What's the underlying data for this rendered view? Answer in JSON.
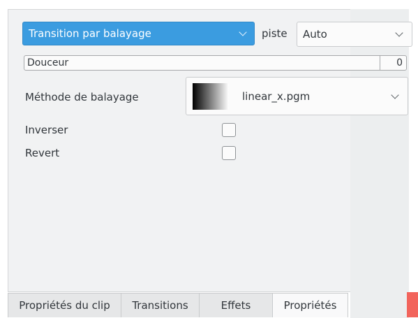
{
  "transition": {
    "selected": "Transition par balayage"
  },
  "track": {
    "label": "piste",
    "selected": "Auto"
  },
  "softness": {
    "label": "Douceur",
    "value": "0"
  },
  "wipe_method": {
    "label": "Méthode de balayage",
    "selected": "linear_x.pgm"
  },
  "options": [
    {
      "label": "Inverser",
      "checked": false
    },
    {
      "label": "Revert",
      "checked": false
    }
  ],
  "tabs": [
    {
      "label": "Propriétés du clip",
      "active": false
    },
    {
      "label": "Transitions",
      "active": false
    },
    {
      "label": "Effets",
      "active": false
    },
    {
      "label": "Propriétés",
      "active": true
    }
  ],
  "colors": {
    "accent": "#3b9ce0",
    "edge_marker": "#f2645c"
  }
}
